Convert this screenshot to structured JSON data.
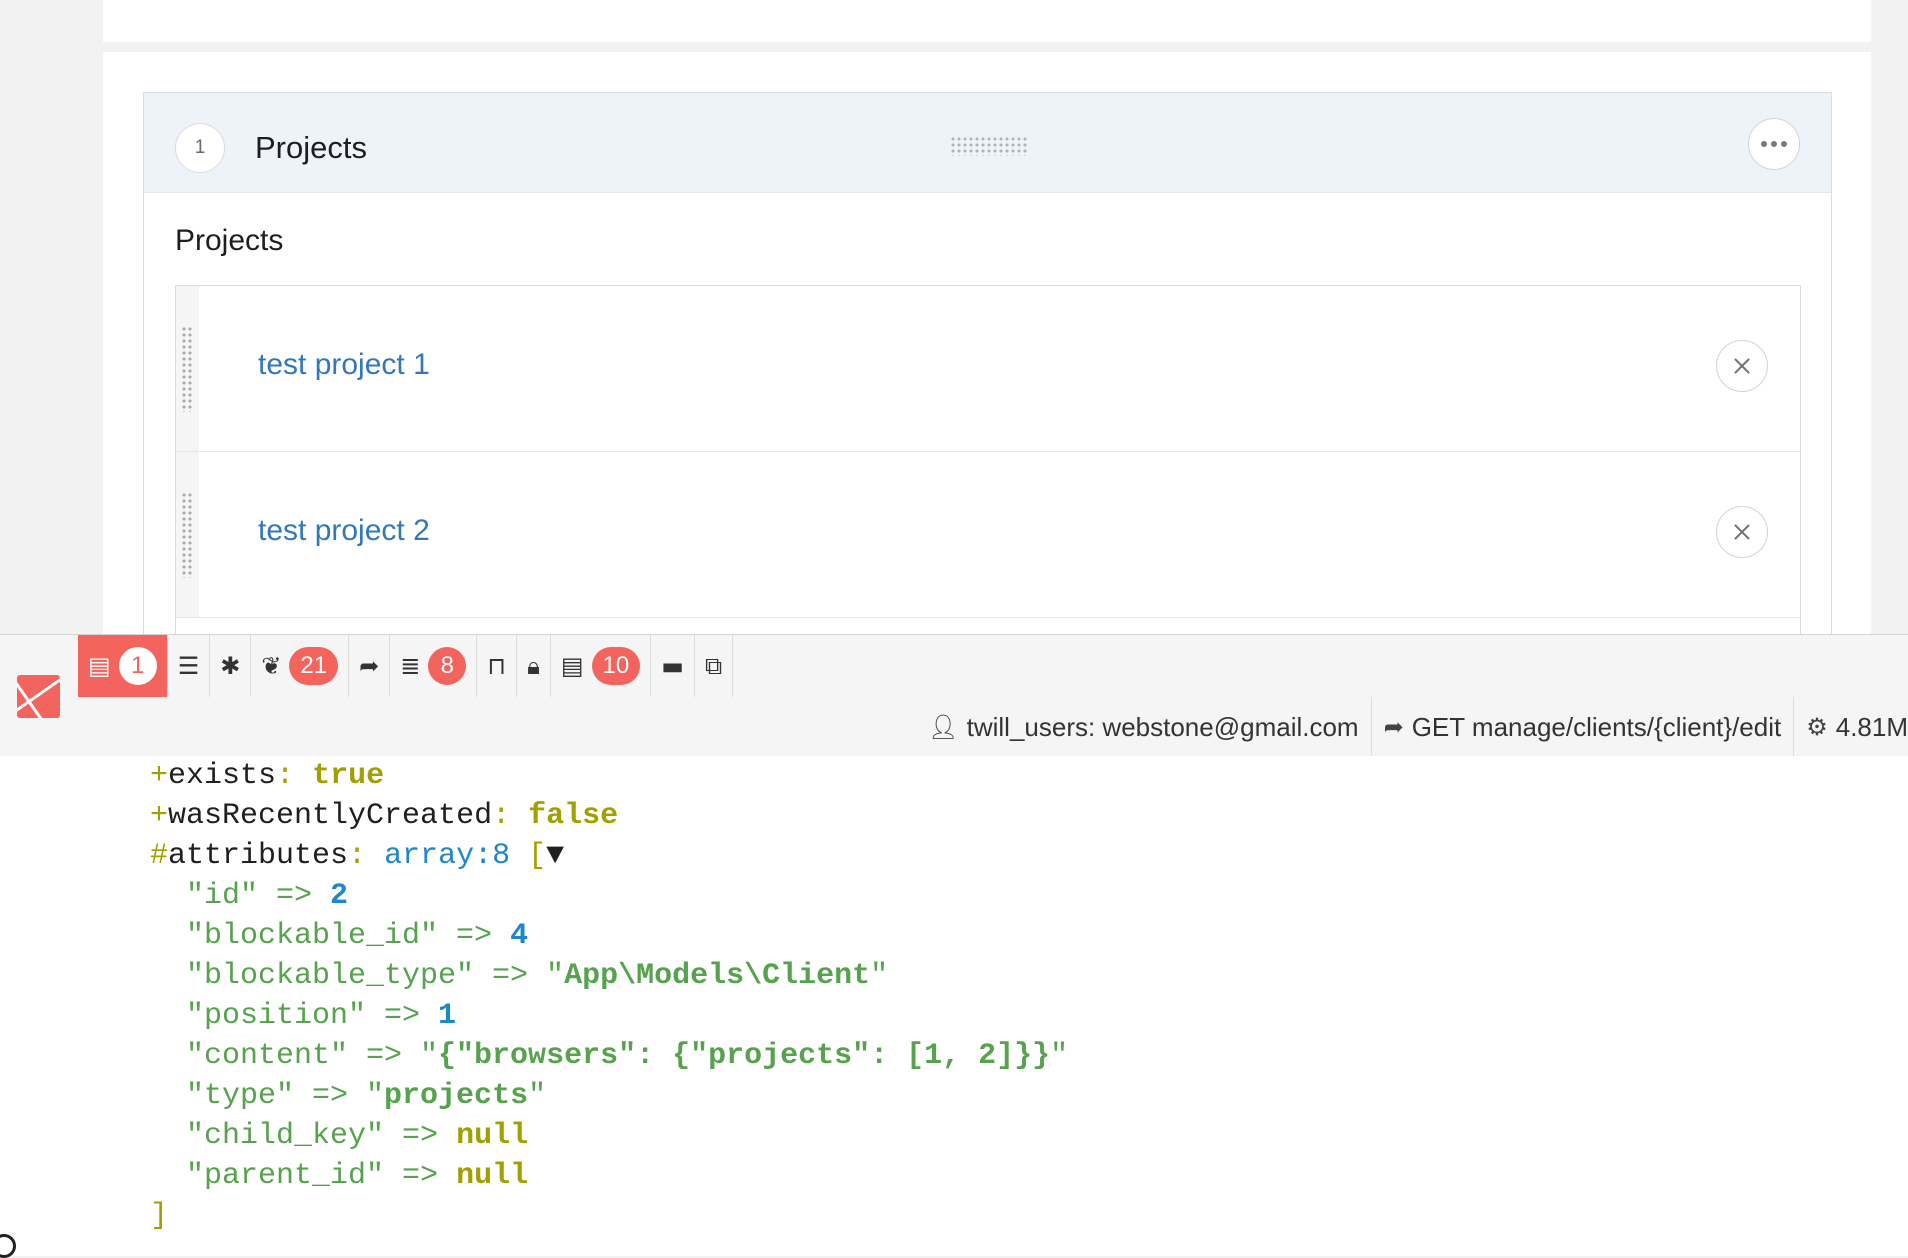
{
  "block": {
    "index": "1",
    "title": "Projects",
    "field_label": "Projects",
    "items": [
      {
        "label": "test project 1"
      },
      {
        "label": "test project 2"
      }
    ]
  },
  "debugbar": {
    "tabs": [
      {
        "icon": "list-icon",
        "glyph": "▤",
        "badge": "1",
        "active": true
      },
      {
        "icon": "server-icon",
        "glyph": "☰",
        "badge": null
      },
      {
        "icon": "bug-icon",
        "glyph": "✱",
        "badge": null
      },
      {
        "icon": "leaf-icon",
        "glyph": "❦",
        "badge": "21"
      },
      {
        "icon": "share-icon",
        "glyph": "➦",
        "badge": null
      },
      {
        "icon": "database-icon",
        "glyph": "≣",
        "badge": "8"
      },
      {
        "icon": "inbox-icon",
        "glyph": "⊓",
        "badge": null
      },
      {
        "icon": "lock-icon",
        "glyph": "🔒︎",
        "badge": null
      },
      {
        "icon": "list-alt-icon",
        "glyph": "▤",
        "badge": "10"
      },
      {
        "icon": "archive-icon",
        "glyph": "▬",
        "badge": null
      },
      {
        "icon": "tags-icon",
        "glyph": "⧉",
        "badge": null
      }
    ],
    "status": {
      "user": "twill_users: webstone@gmail.com",
      "route": "GET manage/clients/{client}/edit",
      "memory": "4.81M"
    },
    "accent_color": "#f4645f"
  },
  "dump": {
    "exists": "true",
    "wasRecentlyCreated": "false",
    "attributes_type": "array:8",
    "attributes": [
      {
        "key": "\"id\"",
        "value": "2",
        "kind": "number"
      },
      {
        "key": "\"blockable_id\"",
        "value": "4",
        "kind": "number"
      },
      {
        "key": "\"blockable_type\"",
        "value": "App\\Models\\Client",
        "kind": "string"
      },
      {
        "key": "\"position\"",
        "value": "1",
        "kind": "number"
      },
      {
        "key": "\"content\"",
        "value": "{\"browsers\": {\"projects\": [1, 2]}}",
        "kind": "string"
      },
      {
        "key": "\"type\"",
        "value": "projects",
        "kind": "string"
      },
      {
        "key": "\"child_key\"",
        "value": "null",
        "kind": "null"
      },
      {
        "key": "\"parent_id\"",
        "value": "null",
        "kind": "null"
      }
    ]
  }
}
